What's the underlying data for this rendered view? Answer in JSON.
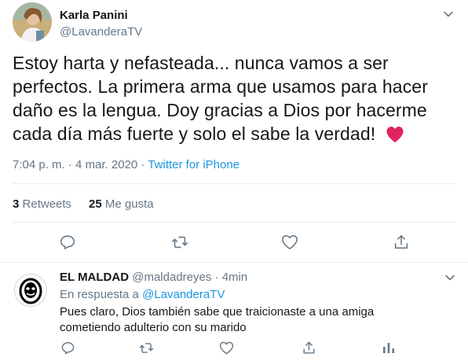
{
  "tweet": {
    "author_name": "Karla Panini",
    "author_handle": "@LavanderaTV",
    "text": "Estoy harta y nefasteada... nunca vamos a ser perfectos. La primera arma que usamos para hacer daño es la lengua. Doy gracias a Dios por hacerme cada día más fuerte y solo el sabe la verdad!",
    "emoji": "red-heart-icon",
    "timestamp": "7:04 p. m. · 4 mar. 2020",
    "separator": " · ",
    "source": "Twitter for iPhone",
    "retweets_count": "3",
    "retweets_label": "Retweets",
    "likes_count": "25",
    "likes_label": "Me gusta"
  },
  "reply": {
    "author_name": "EL MALDAD",
    "author_handle": "@maldadreyes",
    "separator": "·",
    "time": "4min",
    "replying_to_label": "En respuesta a",
    "replying_to_handle": "@LavanderaTV",
    "text": "Pues claro, Dios también sabe que traicionaste a una amiga cometiendo adulterio con su marido"
  },
  "icons": [
    "caret-down-icon",
    "reply-icon",
    "retweet-icon",
    "like-icon",
    "share-icon"
  ],
  "colors": {
    "text": "#14171a",
    "muted": "#657786",
    "link": "#1b95e0",
    "heart": "#e0245e",
    "border": "#e6ecf0"
  }
}
